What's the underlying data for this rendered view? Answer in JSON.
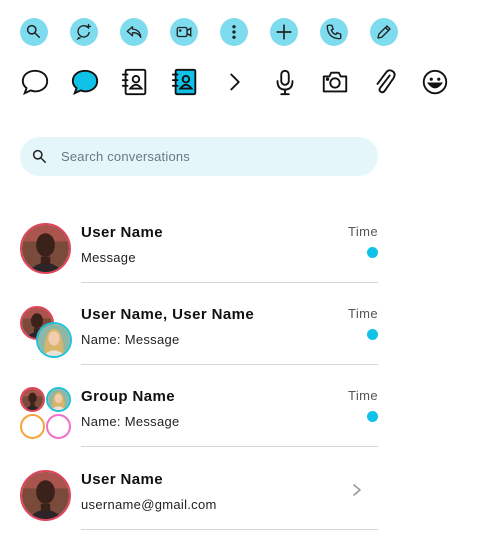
{
  "toolbar_top": {
    "icons": [
      "search-icon",
      "new-chat-icon",
      "reply-icon",
      "video-call-icon",
      "more-vertical-icon",
      "add-icon",
      "phone-icon",
      "edit-pencil-icon"
    ]
  },
  "toolbar_bottom": {
    "icons": [
      "chat-bubble-outline-icon",
      "chat-bubble-filled-icon",
      "contact-book-outline-icon",
      "contact-book-filled-icon",
      "chevron-right-icon",
      "microphone-icon",
      "camera-icon",
      "paperclip-icon",
      "smiley-icon"
    ]
  },
  "search": {
    "placeholder": "Search conversations"
  },
  "conversations": [
    {
      "name": "User Name",
      "message": "Message",
      "time": "Time",
      "unread": true
    },
    {
      "name": "User Name, User Name",
      "message": "Name: Message",
      "time": "Time",
      "unread": true
    },
    {
      "name": "Group Name",
      "message": "Name: Message",
      "time": "Time",
      "unread": true
    },
    {
      "name": "User Name",
      "message": "username@gmail.com",
      "time": "",
      "unread": false
    }
  ],
  "colors": {
    "accent_light": "#7fdcef",
    "accent": "#10c2e8",
    "search_bg": "#e5f6fb",
    "ring_red": "#e2445c",
    "ring_teal": "#1fc3d9",
    "ring_orange": "#f6a43c",
    "ring_pink": "#f170c8"
  }
}
